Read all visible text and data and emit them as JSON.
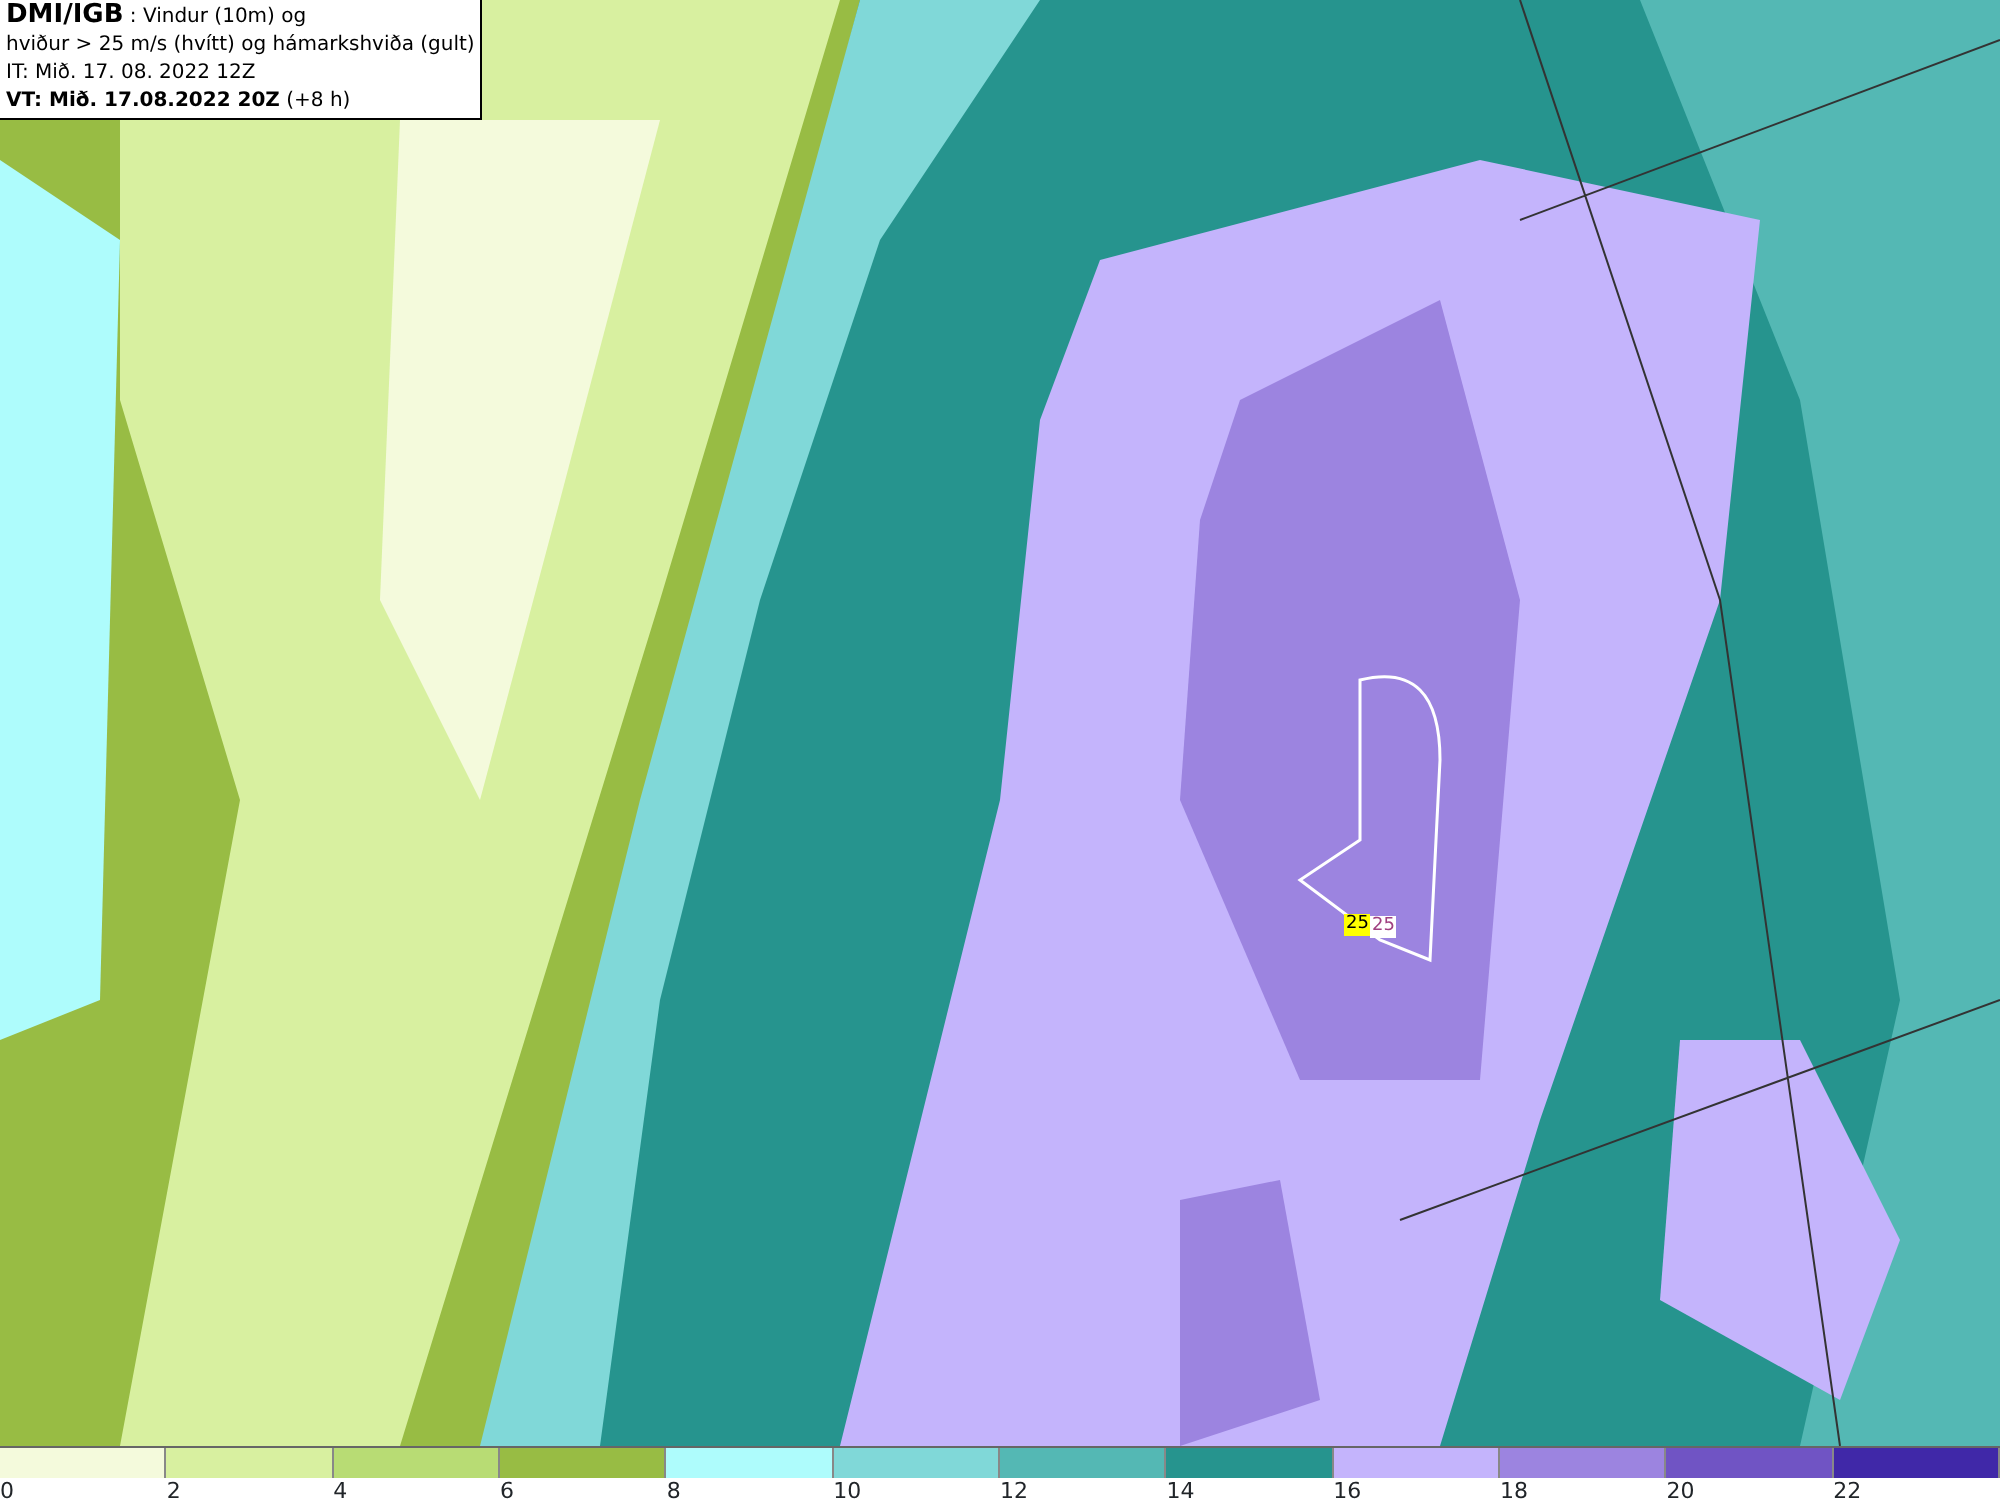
{
  "header": {
    "source": "DMI/IGB",
    "description": ": Vindur (10m) og",
    "line_2": "hviður > 25 m/s (hvítt) og hámarkshviða (gult)",
    "initial_time": "IT: Mið. 17. 08. 2022 12Z",
    "valid_time": "VT: Mið. 17.08.2022 20Z",
    "lead": "(+8 h)"
  },
  "map": {
    "max_gust_label": "25",
    "gust_label": "25"
  },
  "legend": [
    {
      "label": "0",
      "color": "#f4fadc"
    },
    {
      "label": "2",
      "color": "#d8f0a0"
    },
    {
      "label": "4",
      "color": "#b8dc74"
    },
    {
      "label": "6",
      "color": "#98bc44"
    },
    {
      "label": "8",
      "color": "#aefcfc"
    },
    {
      "label": "10",
      "color": "#80d8d8"
    },
    {
      "label": "12",
      "color": "#54b8b4"
    },
    {
      "label": "14",
      "color": "#26948e"
    },
    {
      "label": "16",
      "color": "#c4b4fc"
    },
    {
      "label": "18",
      "color": "#9c84e0"
    },
    {
      "label": "20",
      "color": "#7054c4"
    },
    {
      "label": "22",
      "color": "#4028a8"
    }
  ]
}
